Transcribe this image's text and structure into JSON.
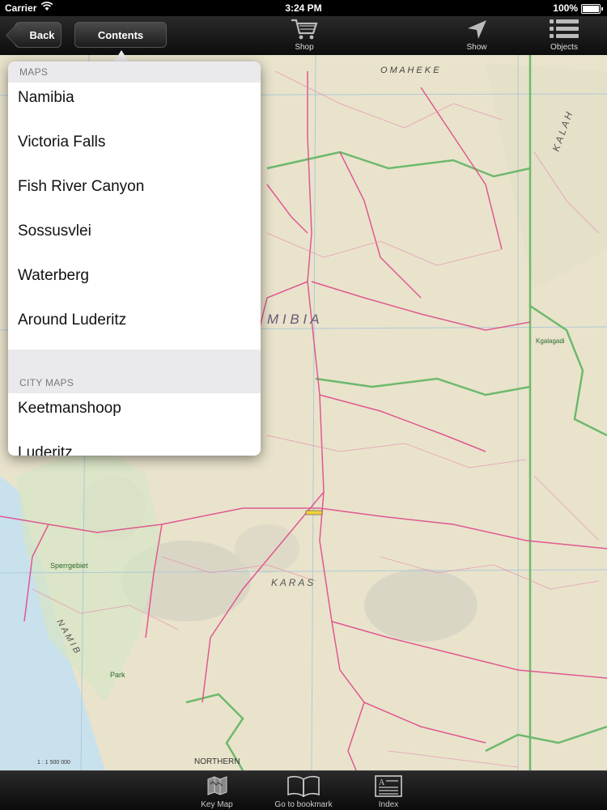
{
  "status_bar": {
    "carrier": "Carrier",
    "time": "3:24 PM",
    "battery": "100%"
  },
  "toolbar": {
    "back_label": "Back",
    "contents_label": "Contents",
    "shop_label": "Shop",
    "show_label": "Show",
    "objects_label": "Objects"
  },
  "contents": {
    "sections": [
      {
        "header": "MAPS",
        "items": [
          "Namibia",
          "Victoria Falls",
          "Fish River Canyon",
          "Sossusvlei",
          "Waterberg",
          "Around Luderitz"
        ]
      },
      {
        "header": "CITY MAPS",
        "items": [
          "Keetmanshoop",
          "Luderitz"
        ]
      }
    ]
  },
  "map": {
    "labels": {
      "omaheke": "O M A H E K E",
      "namibia": "M I B I A",
      "karas": "K A R A S",
      "kalahari": "K A L A H",
      "sperrgebiet": "Sperrgebiet",
      "park": "Park",
      "namib": "N A M I B",
      "northern": "NORTHERN",
      "kgalagadi": "Kgalagadi",
      "scale": "1 : 1 500 000"
    },
    "colors": {
      "land": "#e9e3cc",
      "ocean": "#c9e1ec",
      "road": "#e04a8a",
      "border": "#6db96d",
      "grid": "#a9c7d6"
    }
  },
  "tabbar": {
    "keymap_label": "Key Map",
    "bookmark_label": "Go to bookmark",
    "index_label": "Index"
  }
}
